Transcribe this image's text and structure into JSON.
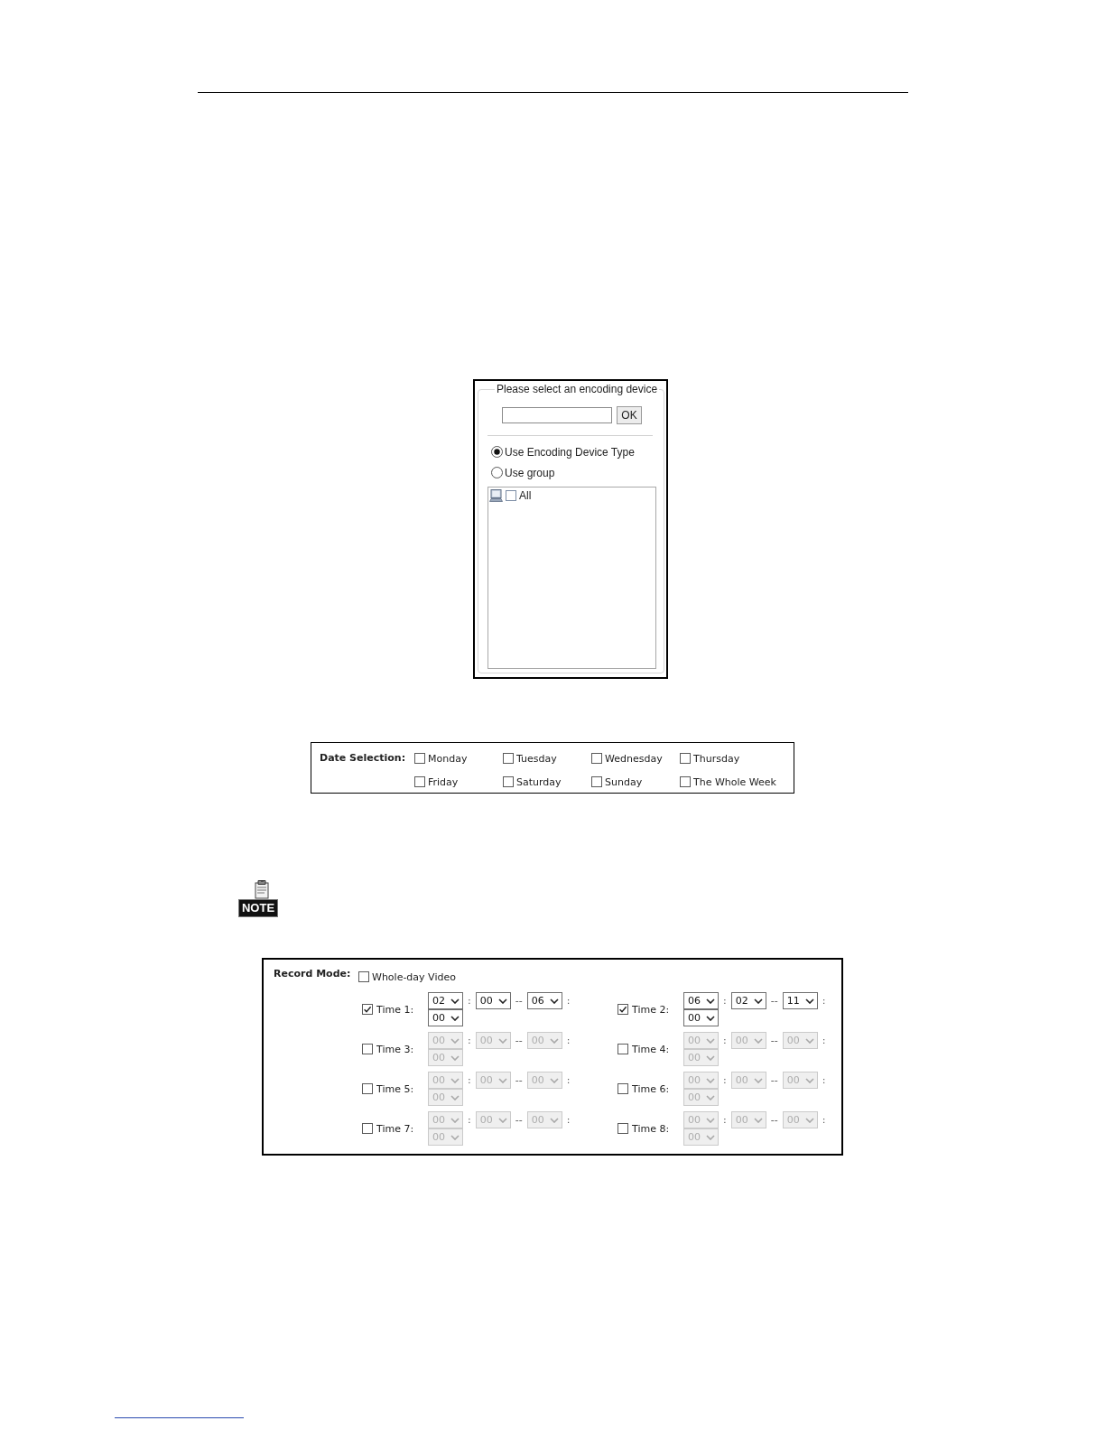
{
  "device_dialog": {
    "title": "Please select an encoding device",
    "search_button": "OK",
    "modes": [
      {
        "label": "Use Encoding Device Type",
        "selected": true
      },
      {
        "label": "Use group",
        "selected": false
      }
    ],
    "tree": [
      {
        "label": "All",
        "checked": false
      }
    ]
  },
  "date_selection": {
    "label": "Date Selection:",
    "days": [
      {
        "label": "Monday",
        "checked": false
      },
      {
        "label": "Tuesday",
        "checked": false
      },
      {
        "label": "Wednesday",
        "checked": false
      },
      {
        "label": "Thursday",
        "checked": false
      },
      {
        "label": "Friday",
        "checked": false
      },
      {
        "label": "Saturday",
        "checked": false
      },
      {
        "label": "Sunday",
        "checked": false
      },
      {
        "label": "The Whole Week",
        "checked": false
      }
    ]
  },
  "note": {
    "label": "NOTE"
  },
  "record_mode": {
    "label": "Record Mode:",
    "whole_day": {
      "label": "Whole-day Video",
      "checked": false
    },
    "periods": [
      {
        "label": "Time 1:",
        "checked": true,
        "disabled": false,
        "values": [
          "02",
          "00",
          "06",
          "00"
        ],
        "separators": [
          ":",
          "--",
          ":"
        ]
      },
      {
        "label": "Time 2:",
        "checked": true,
        "disabled": false,
        "values": [
          "06",
          "02",
          "11",
          "00"
        ],
        "separators": [
          ":",
          "--",
          ":"
        ]
      },
      {
        "label": "Time 3:",
        "checked": false,
        "disabled": true,
        "values": [
          "00",
          "00",
          "00",
          "00"
        ],
        "separators": [
          ":",
          "--",
          ":"
        ]
      },
      {
        "label": "Time 4:",
        "checked": false,
        "disabled": true,
        "values": [
          "00",
          "00",
          "00",
          "00"
        ],
        "separators": [
          ":",
          "--",
          ":"
        ]
      },
      {
        "label": "Time 5:",
        "checked": false,
        "disabled": true,
        "values": [
          "00",
          "00",
          "00",
          "00"
        ],
        "separators": [
          ":",
          "--",
          ":"
        ]
      },
      {
        "label": "Time 6:",
        "checked": false,
        "disabled": true,
        "values": [
          "00",
          "00",
          "00",
          "00"
        ],
        "separators": [
          ":",
          "--",
          ":"
        ]
      },
      {
        "label": "Time 7:",
        "checked": false,
        "disabled": true,
        "values": [
          "00",
          "00",
          "00",
          "00"
        ],
        "separators": [
          ":",
          "--",
          ":"
        ]
      },
      {
        "label": "Time 8:",
        "checked": false,
        "disabled": true,
        "values": [
          "00",
          "00",
          "00",
          "00"
        ],
        "separators": [
          ":",
          "--",
          ":"
        ]
      }
    ]
  }
}
